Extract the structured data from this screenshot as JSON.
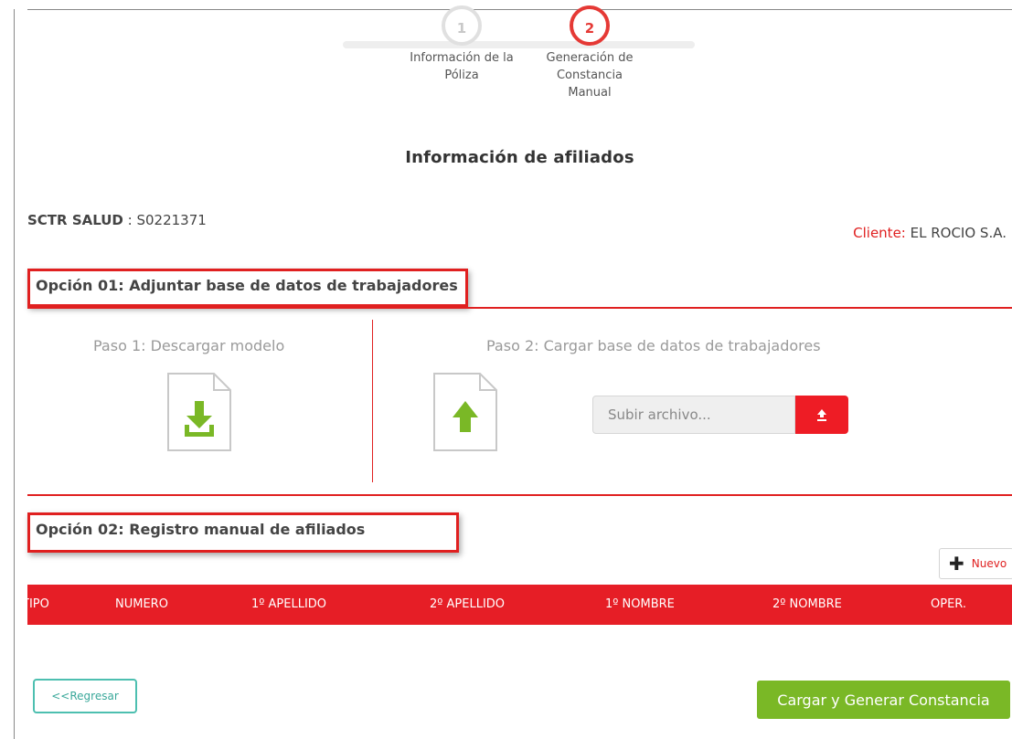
{
  "stepper": {
    "steps": [
      {
        "number": "1",
        "label_lines": [
          "Información de la",
          "Póliza"
        ],
        "active": false
      },
      {
        "number": "2",
        "label_lines": [
          "Generación de",
          "Constancia",
          "Manual"
        ],
        "active": true
      }
    ]
  },
  "section_title": "Información de afiliados",
  "policy": {
    "label": "SCTR SALUD",
    "separator": " : ",
    "value": "S0221371"
  },
  "client": {
    "label": "Cliente:",
    "value": " EL ROCIO S.A."
  },
  "option1": {
    "title": "Opción 01: Adjuntar base de datos de trabajadores",
    "step1_label": "Paso 1: Descargar modelo",
    "step2_label": "Paso 2: Cargar base de datos de trabajadores",
    "download_icon": "file-download-icon",
    "upload_file_icon": "file-upload-icon",
    "upload_placeholder": "Subir archivo...",
    "upload_button_icon": "upload-icon"
  },
  "option2": {
    "title": "Opción 02: Registro manual de afiliados",
    "new_button": "Nuevo",
    "columns": [
      "TIPO",
      "NUMERO",
      "1º APELLIDO",
      "2º APELLIDO",
      "1º NOMBRE",
      "2º NOMBRE",
      "OPER."
    ]
  },
  "footer": {
    "back_button": "<<Regresar",
    "submit_button": "Cargar y Generar Constancia"
  },
  "colors": {
    "accent_red": "#e61e26",
    "submit_green": "#7ab826",
    "back_teal": "#4dbfb0"
  }
}
